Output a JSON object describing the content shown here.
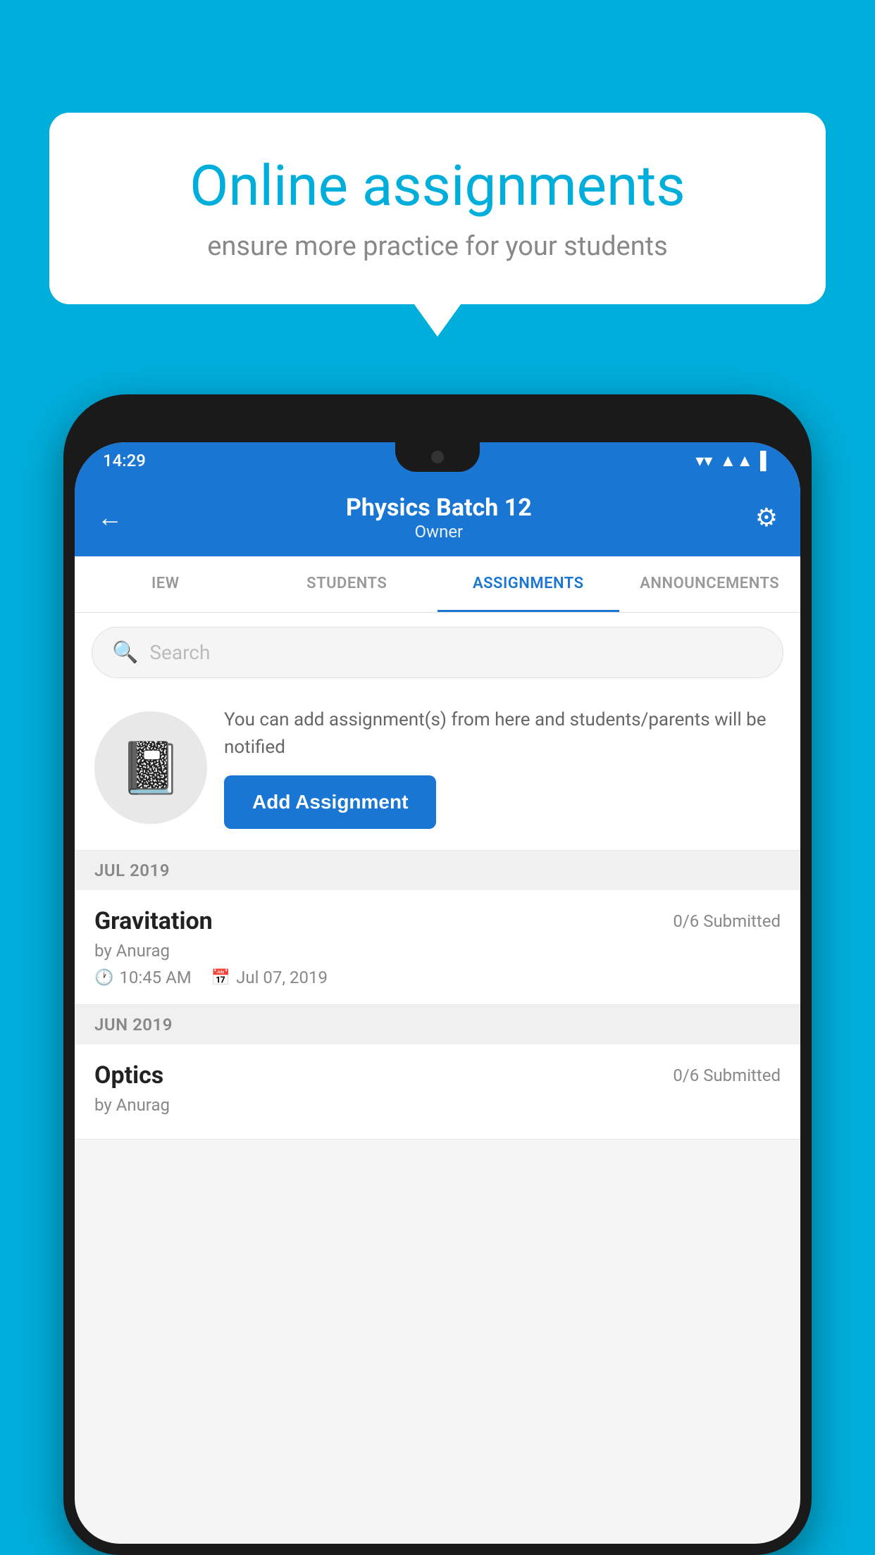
{
  "background_color": "#00AEDB",
  "speech_bubble": {
    "title": "Online assignments",
    "subtitle": "ensure more practice for your students"
  },
  "phone": {
    "status_bar": {
      "time": "14:29",
      "icons": [
        "wifi",
        "signal",
        "battery"
      ]
    },
    "app_bar": {
      "title": "Physics Batch 12",
      "subtitle": "Owner",
      "back_label": "←",
      "settings_label": "⚙"
    },
    "tabs": [
      {
        "label": "IEW",
        "active": false
      },
      {
        "label": "STUDENTS",
        "active": false
      },
      {
        "label": "ASSIGNMENTS",
        "active": true
      },
      {
        "label": "ANNOUNCEMENTS",
        "active": false
      }
    ],
    "search": {
      "placeholder": "Search"
    },
    "promo": {
      "text": "You can add assignment(s) from here and students/parents will be notified",
      "button_label": "Add Assignment"
    },
    "sections": [
      {
        "header": "JUL 2019",
        "assignments": [
          {
            "title": "Gravitation",
            "submitted": "0/6 Submitted",
            "author": "by Anurag",
            "time": "10:45 AM",
            "date": "Jul 07, 2019"
          }
        ]
      },
      {
        "header": "JUN 2019",
        "assignments": [
          {
            "title": "Optics",
            "submitted": "0/6 Submitted",
            "author": "by Anurag",
            "time": "",
            "date": ""
          }
        ]
      }
    ]
  }
}
